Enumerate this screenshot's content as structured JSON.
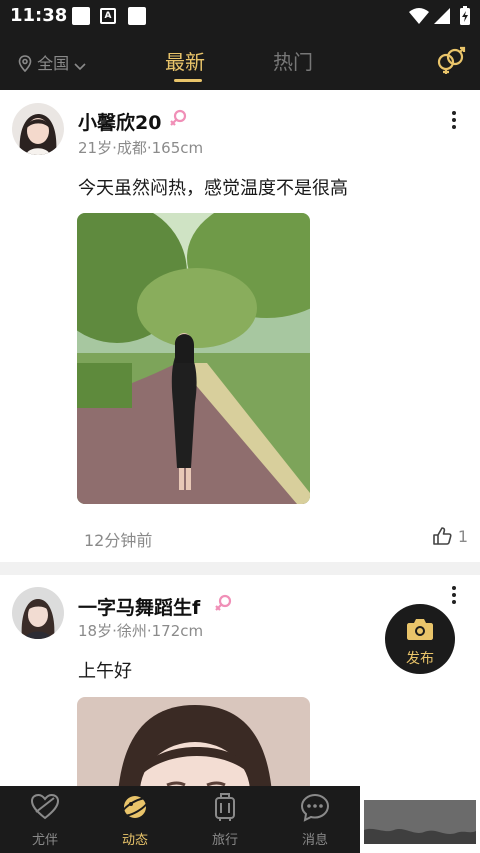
{
  "status_bar": {
    "time": "11:38",
    "notif_icon": "A"
  },
  "top_nav": {
    "location": "全国",
    "tabs": [
      {
        "label": "最新",
        "active": true
      },
      {
        "label": "热门",
        "active": false
      }
    ],
    "accent_color": "#e9c46a"
  },
  "posts": [
    {
      "name": "小馨欣20",
      "meta": "21岁·成都·165cm",
      "content": "今天虽然闷热，感觉温度不是很高",
      "time": "12分钟前",
      "likes": "1"
    },
    {
      "name": "一字马舞蹈生f",
      "meta": "18岁·徐州·172cm",
      "content": "上午好"
    }
  ],
  "publish_label": "发布",
  "bottom_nav": [
    {
      "label": "尤伴",
      "icon": "heart-icon"
    },
    {
      "label": "动态",
      "icon": "planet-icon",
      "active": true
    },
    {
      "label": "旅行",
      "icon": "luggage-icon"
    },
    {
      "label": "消息",
      "icon": "chat-bubble-icon"
    }
  ]
}
